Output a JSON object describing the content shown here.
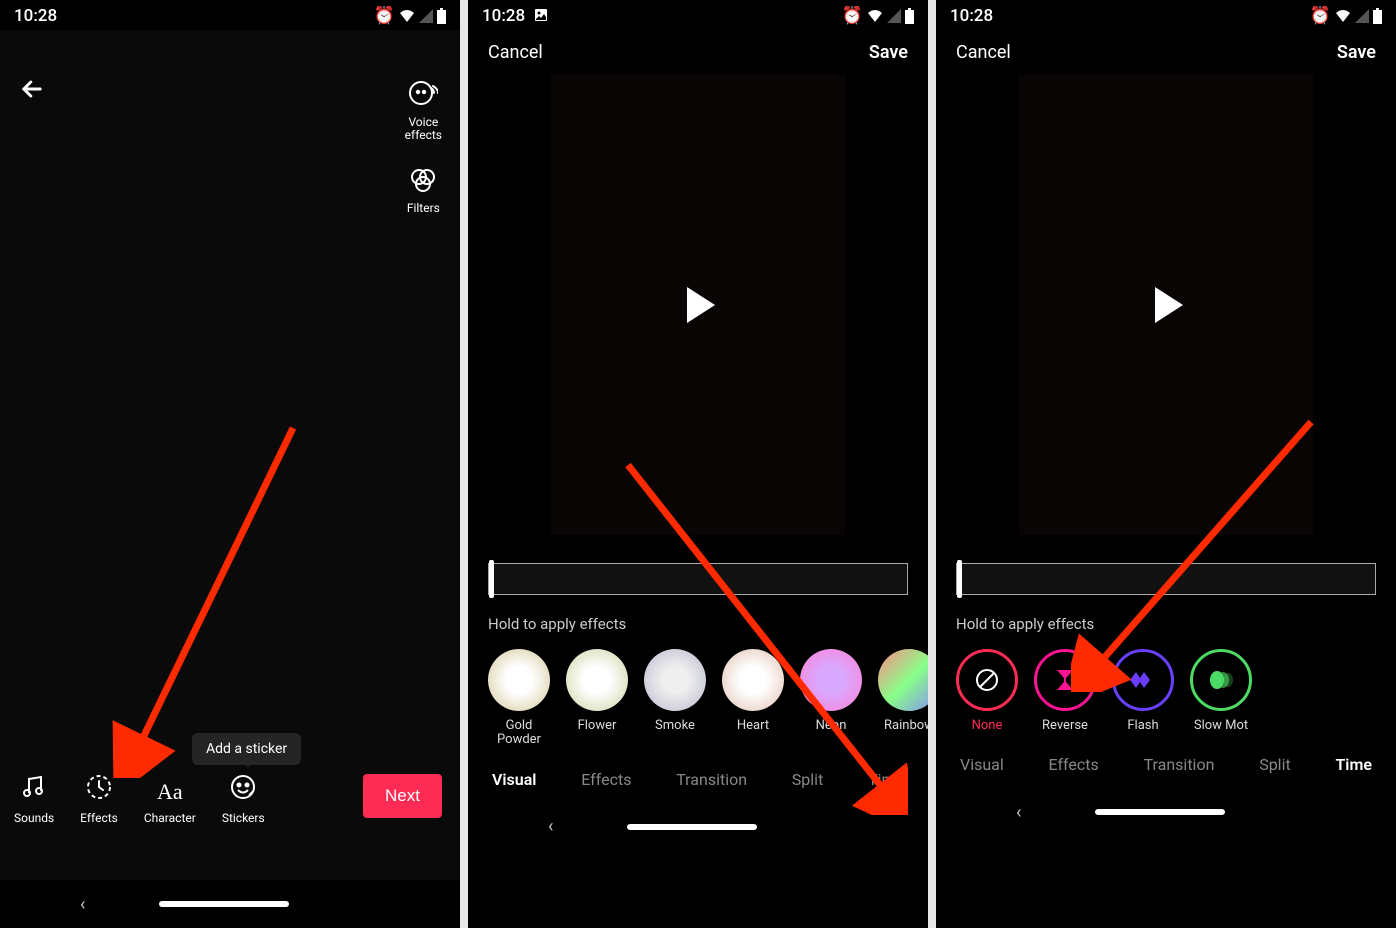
{
  "status": {
    "time": "10:28",
    "time_with_notif": "10:28"
  },
  "screen1": {
    "side_options": {
      "voice_effects": "Voice\neffects",
      "filters": "Filters"
    },
    "tooltip": "Add a sticker",
    "bottom": {
      "sounds": "Sounds",
      "effects": "Effects",
      "character": "Character",
      "stickers": "Stickers"
    },
    "next": "Next"
  },
  "editor": {
    "cancel": "Cancel",
    "save": "Save",
    "hint": "Hold to apply effects",
    "tabs": {
      "visual": "Visual",
      "effects": "Effects",
      "transition": "Transition",
      "split": "Split",
      "time": "Time"
    }
  },
  "visual_effects": [
    {
      "label": "Gold\nPowder"
    },
    {
      "label": "Flower"
    },
    {
      "label": "Smoke"
    },
    {
      "label": "Heart"
    },
    {
      "label": "Neon"
    },
    {
      "label": "Rainbow"
    }
  ],
  "time_effects": [
    {
      "label": "None",
      "color": "red"
    },
    {
      "label": "Reverse",
      "color": "pink"
    },
    {
      "label": "Flash",
      "color": "purple"
    },
    {
      "label": "Slow Mot",
      "color": "green"
    }
  ]
}
